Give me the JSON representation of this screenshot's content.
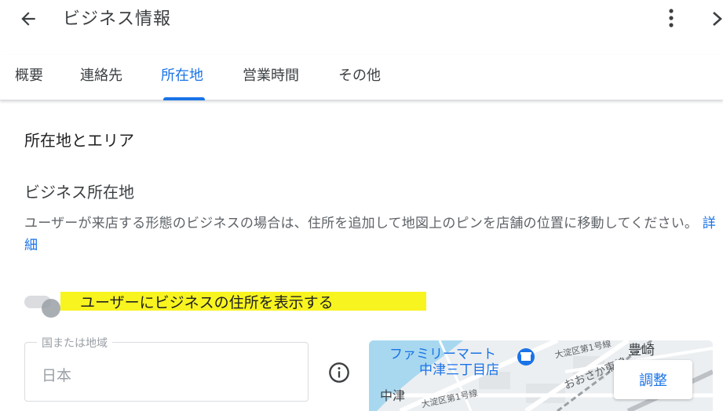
{
  "header": {
    "title": "ビジネス情報",
    "back_icon": "arrow-left-icon",
    "more_icon": "more-vert-icon",
    "close_icon": "chevron-right-icon"
  },
  "tabs": [
    {
      "label": "概要",
      "active": false
    },
    {
      "label": "連絡先",
      "active": false
    },
    {
      "label": "所在地",
      "active": true
    },
    {
      "label": "営業時間",
      "active": false
    },
    {
      "label": "その他",
      "active": false
    }
  ],
  "section": {
    "title": "所在地とエリア",
    "subtitle": "ビジネス所在地",
    "description": "ユーザーが来店する形態のビジネスの場合は、住所を追加して地図上のピンを店舗の位置に移動してください。",
    "learn_more": "詳細"
  },
  "toggle": {
    "label": "ユーザーにビジネスの住所を表示する",
    "checked": false,
    "highlight_color": "#f8f41f"
  },
  "country_field": {
    "label": "国または地域",
    "placeholder": "日本"
  },
  "map": {
    "place_name_line1": "ファミリーマート",
    "place_name_line2": "中津三丁目店",
    "street_1": "大淀区第1号線",
    "street_2": "大淀区第1号線",
    "road_label": "おおさか東線",
    "area_label": "豊崎",
    "area_label_2": "中津",
    "adjust_button": "調整"
  },
  "colors": {
    "accent": "#1a73e8",
    "text_primary": "#202124",
    "text_secondary": "#5f6368"
  }
}
